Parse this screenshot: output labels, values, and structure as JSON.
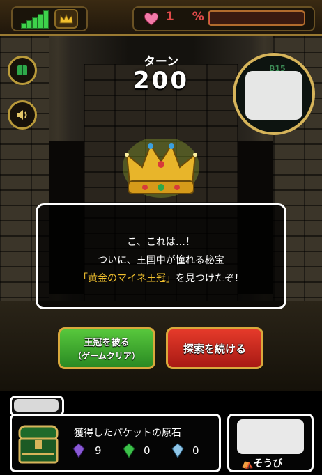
{
  "status_bar": {
    "signal_level": 5,
    "hp_label": "1 %",
    "hp_percent": 1,
    "colors": {
      "signal": "#3ed24b",
      "hp": "#e04a4a"
    },
    "icons": [
      "signal-bars-icon",
      "crown-icon",
      "heart-icon"
    ]
  },
  "turn": {
    "label": "ターン",
    "value": "200"
  },
  "map": {
    "floor": "B15"
  },
  "side_buttons": [
    {
      "icon": "book-icon"
    },
    {
      "icon": "speaker-icon"
    }
  ],
  "dialog": {
    "line1": "こ、これは…！",
    "line2": "ついに、王国中が憧れる秘宝",
    "line3_highlight": "「黄金のマイネ王冠」",
    "line3_rest": "を見つけたぞ！"
  },
  "buttons": {
    "wear_crown_line1": "王冠を被る",
    "wear_crown_line2": "（ゲームクリア）",
    "continue": "探索を続ける",
    "colors": {
      "wear": "#3fae2f",
      "continue": "#d42c20"
    }
  },
  "inventory": {
    "title": "獲得したパケットの原石",
    "stones": [
      {
        "icon": "purple-gem-icon",
        "count": "9",
        "color": "#8a5ad6"
      },
      {
        "icon": "green-gem-icon",
        "count": "0",
        "color": "#3cc24a"
      },
      {
        "icon": "blue-gem-icon",
        "count": "0",
        "color": "#8fc6e8"
      }
    ],
    "chest_icon": "treasure-chest-icon"
  },
  "equipment": {
    "label": "そうび"
  }
}
